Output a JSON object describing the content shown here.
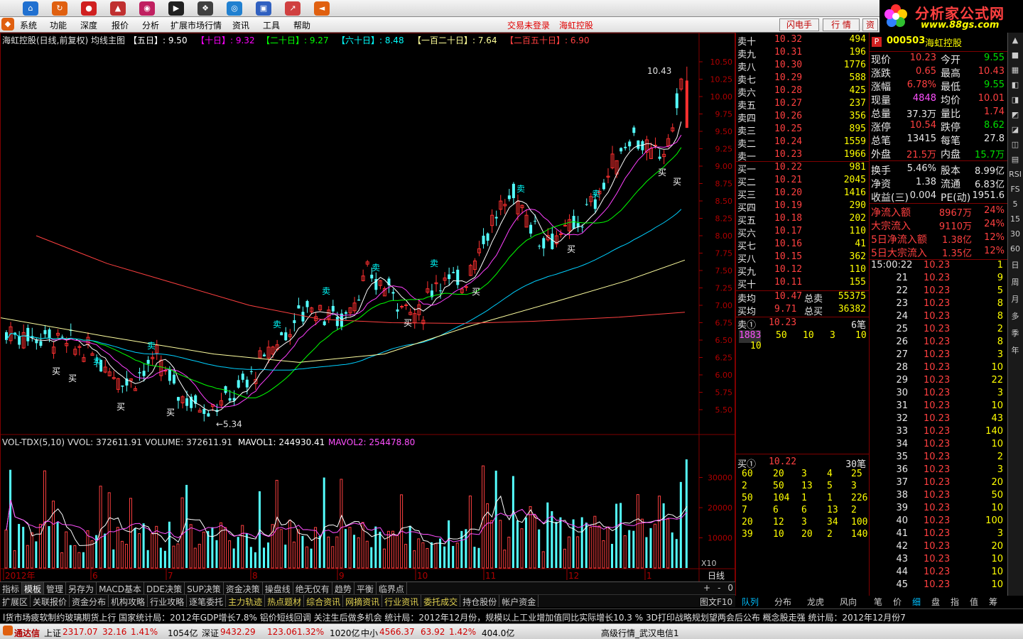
{
  "toolbar": {
    "icons": [
      "home-icon",
      "refresh-icon",
      "qq-icon",
      "stock-icon",
      "chart-icon",
      "play-icon",
      "film-icon",
      "browser-icon",
      "cube-icon",
      "chart-up-icon",
      "back-icon"
    ]
  },
  "menu": {
    "items": [
      "系统",
      "功能",
      "深度",
      "报价",
      "分析",
      "扩展市场行情",
      "资讯",
      "工具",
      "帮助"
    ],
    "trade_status": "交易未登录",
    "stock_name": "海虹控股",
    "btn_flash": "闪电手",
    "btn_quote": "行  情",
    "btn_trade": "资"
  },
  "logo": {
    "title": "分析家公式网",
    "url": "www.88gs.com"
  },
  "chart": {
    "title": "海虹控股(日线,前复权) 均线主图",
    "ma_labels": [
      {
        "label": "【五日】: 9.50",
        "color": "#ffffff"
      },
      {
        "label": "【十日】: 9.32",
        "color": "#ff00ff"
      },
      {
        "label": "【二十日】: 9.27",
        "color": "#00ff00"
      },
      {
        "label": "【六十日】: 8.48",
        "color": "#00ffff"
      },
      {
        "label": "【一百二十日】: 7.64",
        "color": "#ffff99"
      },
      {
        "label": "【二百五十日】: 6.90",
        "color": "#ff4040"
      }
    ],
    "price_ticks": [
      "10.50",
      "10.25",
      "10.00",
      "9.75",
      "9.50",
      "9.25",
      "9.00",
      "8.75",
      "8.50",
      "8.25",
      "8.00",
      "7.75",
      "7.50",
      "7.25",
      "7.00",
      "6.75",
      "6.50",
      "6.25",
      "6.00",
      "5.75",
      "5.50"
    ],
    "high_label": "10.43",
    "low_label": "5.34",
    "signals_buy": "买",
    "signals_sell": "卖",
    "vol_title": "VOL-TDX(5,10)  VVOL: 372611.91",
    "vol_label": "VOLUME: 372611.91",
    "mavol1": "MAVOL1: 244930.41",
    "mavol2": "MAVOL2: 254478.80",
    "vol_ticks": [
      "30000",
      "20000",
      "10000"
    ],
    "vol_unit": "X10",
    "period": "日线",
    "period_ctrl": [
      "+",
      "-",
      "0"
    ],
    "x_labels": [
      "2012年",
      "6",
      "7",
      "8",
      "9",
      "10",
      "11",
      "12",
      "1"
    ],
    "f10": "图文F10"
  },
  "chart_data": {
    "type": "candlestick",
    "title": "海虹控股(日线,前复权) 均线主图",
    "y_range": [
      5.3,
      10.6
    ],
    "x_months": [
      "2012年",
      "6",
      "7",
      "8",
      "9",
      "10",
      "11",
      "12",
      "1"
    ],
    "ma_values": {
      "MA5": 9.5,
      "MA10": 9.32,
      "MA20": 9.27,
      "MA60": 8.48,
      "MA120": 7.64,
      "MA250": 6.9
    },
    "high": 10.43,
    "low": 5.34,
    "volume": {
      "VOLUME": 372611.91,
      "MAVOL1": 244930.41,
      "MAVOL2": 254478.8,
      "y_ticks": [
        30000,
        20000,
        10000
      ]
    }
  },
  "orderbook": {
    "sells": [
      [
        "卖十",
        "10.32",
        "494"
      ],
      [
        "卖九",
        "10.31",
        "196"
      ],
      [
        "卖八",
        "10.30",
        "1776"
      ],
      [
        "卖七",
        "10.29",
        "588"
      ],
      [
        "卖六",
        "10.28",
        "425"
      ],
      [
        "卖五",
        "10.27",
        "237"
      ],
      [
        "卖四",
        "10.26",
        "356"
      ],
      [
        "卖三",
        "10.25",
        "895"
      ],
      [
        "卖二",
        "10.24",
        "1559"
      ],
      [
        "卖一",
        "10.23",
        "1966"
      ]
    ],
    "buys": [
      [
        "买一",
        "10.22",
        "981"
      ],
      [
        "买二",
        "10.21",
        "2045"
      ],
      [
        "买三",
        "10.20",
        "1416"
      ],
      [
        "买四",
        "10.19",
        "290"
      ],
      [
        "买五",
        "10.18",
        "202"
      ],
      [
        "买六",
        "10.17",
        "110"
      ],
      [
        "买七",
        "10.16",
        "41"
      ],
      [
        "买八",
        "10.15",
        "362"
      ],
      [
        "买九",
        "10.12",
        "110"
      ],
      [
        "买十",
        "10.11",
        "155"
      ]
    ],
    "avg_sell_label": "卖均",
    "avg_sell": "10.47",
    "total_sell_label": "总卖",
    "total_sell": "55375",
    "avg_buy_label": "买均",
    "avg_buy": "9.71",
    "total_buy_label": "总买",
    "total_buy": "36382",
    "sell1_label": "卖①",
    "sell1_price": "10.23",
    "sell1_count": "6笔",
    "sell1_queue": [
      "1883",
      "50",
      "10",
      "3",
      "10"
    ],
    "sell1_queue2": [
      "10"
    ],
    "buy1_label": "买①",
    "buy1_price": "10.22",
    "buy1_count": "30笔",
    "buy1_queue": [
      [
        "60",
        "20",
        "3",
        "4",
        "25"
      ],
      [
        "2",
        "50",
        "13",
        "5",
        "3"
      ],
      [
        "50",
        "104",
        "1",
        "1",
        "226"
      ],
      [
        "7",
        "6",
        "6",
        "13",
        "2"
      ],
      [
        "20",
        "12",
        "3",
        "34",
        "100"
      ],
      [
        "39",
        "10",
        "20",
        "2",
        "140"
      ]
    ]
  },
  "quote": {
    "code": "000503",
    "name": "海虹控股",
    "badge": "P",
    "rows": [
      [
        "现价",
        "10.23",
        "今开",
        "9.55"
      ],
      [
        "涨跌",
        "0.65",
        "最高",
        "10.43"
      ],
      [
        "涨幅",
        "6.78%",
        "最低",
        "9.55"
      ],
      [
        "现量",
        "4848",
        "均价",
        "10.01"
      ],
      [
        "总量",
        "37.3万",
        "量比",
        "1.74"
      ],
      [
        "涨停",
        "10.54",
        "跌停",
        "8.62"
      ],
      [
        "总笔",
        "13415",
        "每笔",
        "27.8"
      ],
      [
        "外盘",
        "21.5万",
        "内盘",
        "15.7万"
      ],
      [
        "换手",
        "5.46%",
        "股本",
        "8.99亿"
      ],
      [
        "净资",
        "1.38",
        "流通",
        "6.83亿"
      ],
      [
        "收益(三)",
        "0.004",
        "PE(动)",
        "1951.6"
      ]
    ],
    "flow": [
      [
        "净流入额",
        "8967万",
        "24%"
      ],
      [
        "大宗流入",
        "9110万",
        "24%"
      ],
      [
        "5日净流入额",
        "1.38亿",
        "12%"
      ],
      [
        "5日大宗流入",
        "1.35亿",
        "12%"
      ]
    ],
    "ticks_time": "15:00:22",
    "ticks": [
      [
        "",
        "10.23",
        "1"
      ],
      [
        "21",
        "10.23",
        "9"
      ],
      [
        "22",
        "10.23",
        "5"
      ],
      [
        "23",
        "10.23",
        "8"
      ],
      [
        "24",
        "10.23",
        "8"
      ],
      [
        "25",
        "10.23",
        "2"
      ],
      [
        "26",
        "10.23",
        "8"
      ],
      [
        "27",
        "10.23",
        "3"
      ],
      [
        "28",
        "10.23",
        "10"
      ],
      [
        "29",
        "10.23",
        "22"
      ],
      [
        "30",
        "10.23",
        "3"
      ],
      [
        "31",
        "10.23",
        "10"
      ],
      [
        "32",
        "10.23",
        "43"
      ],
      [
        "33",
        "10.23",
        "140"
      ],
      [
        "34",
        "10.23",
        "10"
      ],
      [
        "35",
        "10.23",
        "2"
      ],
      [
        "36",
        "10.23",
        "3"
      ],
      [
        "37",
        "10.23",
        "20"
      ],
      [
        "38",
        "10.23",
        "50"
      ],
      [
        "39",
        "10.23",
        "10"
      ],
      [
        "40",
        "10.23",
        "100"
      ],
      [
        "41",
        "10.23",
        "3"
      ],
      [
        "42",
        "10.23",
        "20"
      ],
      [
        "43",
        "10.23",
        "10"
      ],
      [
        "44",
        "10.23",
        "10"
      ],
      [
        "45",
        "10.23",
        "10"
      ]
    ]
  },
  "right_toolbar": [
    "RSI",
    "FS",
    "5",
    "15",
    "30",
    "60",
    "日",
    "周",
    "月",
    "多",
    "季",
    "年"
  ],
  "bottom_tabs_ob": [
    "队列",
    "分布",
    "龙虎",
    "风向"
  ],
  "bottom_tabs_qt": [
    "笔",
    "价",
    "细",
    "盘",
    "指",
    "值",
    "筹"
  ],
  "tabs1": [
    "指标",
    "模板",
    "管理",
    "另存为",
    "MACD基本",
    "DDE决策",
    "SUP决策",
    "资金决策",
    "操盘线",
    "绝无仅有",
    "趋势",
    "平衡",
    "临界点"
  ],
  "tabs2": [
    "扩展区",
    "关联报价",
    "资金分布",
    "机构攻略",
    "行业攻略",
    "逐笔委托",
    "主力轨迹",
    "热点题材",
    "综合资讯",
    "网摘资讯",
    "行业资讯",
    "委托成交",
    "持仓股份",
    "帐户资金"
  ],
  "ticker": "l货市场疲软制约玻璃期货上行      国家统计局：2012年GDP增长7.8%      铝价短线回调 关注生后做多机会      统计局：2012年12月份，规模以上工业增加值同比实际增长10.3 %      3D打印战略规划望两会后公布 概念股走强      统计局：2012年12月份7",
  "status": {
    "app": "通达信",
    "sh_label": "上证",
    "sh": "2317.07",
    "sh_chg": "32.16",
    "sh_pct": "1.41%",
    "sh_amt": "1054亿",
    "sz_label": "深证",
    "sz": "9432.29",
    "sz_chg": "123.06",
    "sz_pct": "1.32%",
    "sz_amt": "1020亿",
    "zx_label": "中小",
    "zx": "4566.37",
    "zx_chg": "63.92",
    "zx_pct": "1.42%",
    "zx_amt": "404.0亿",
    "server": "高级行情_武汉电信1"
  }
}
